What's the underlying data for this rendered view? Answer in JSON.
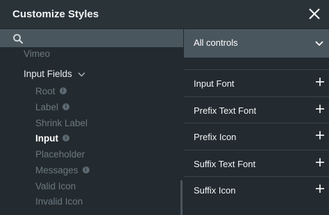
{
  "header": {
    "title": "Customize Styles"
  },
  "search": {
    "placeholder": "",
    "value": ""
  },
  "dropdown": {
    "selected": "All controls"
  },
  "tree": {
    "items": [
      {
        "label": "Vimeo"
      },
      {
        "label": "Input Fields"
      },
      {
        "label": "Root"
      },
      {
        "label": "Label"
      },
      {
        "label": "Shrink Label"
      },
      {
        "label": "Input"
      },
      {
        "label": "Placeholder"
      },
      {
        "label": "Messages"
      },
      {
        "label": "Valid Icon"
      },
      {
        "label": "Invalid Icon"
      }
    ],
    "info_glyph": "i"
  },
  "style_rows": [
    {
      "label": "Input Font"
    },
    {
      "label": "Prefix Text Font"
    },
    {
      "label": "Prefix Icon"
    },
    {
      "label": "Suffix Text Font"
    },
    {
      "label": "Suffix Icon"
    }
  ],
  "colors": {
    "background": "#232b30",
    "header": "#2a3338",
    "search_bg": "#4a565e"
  }
}
